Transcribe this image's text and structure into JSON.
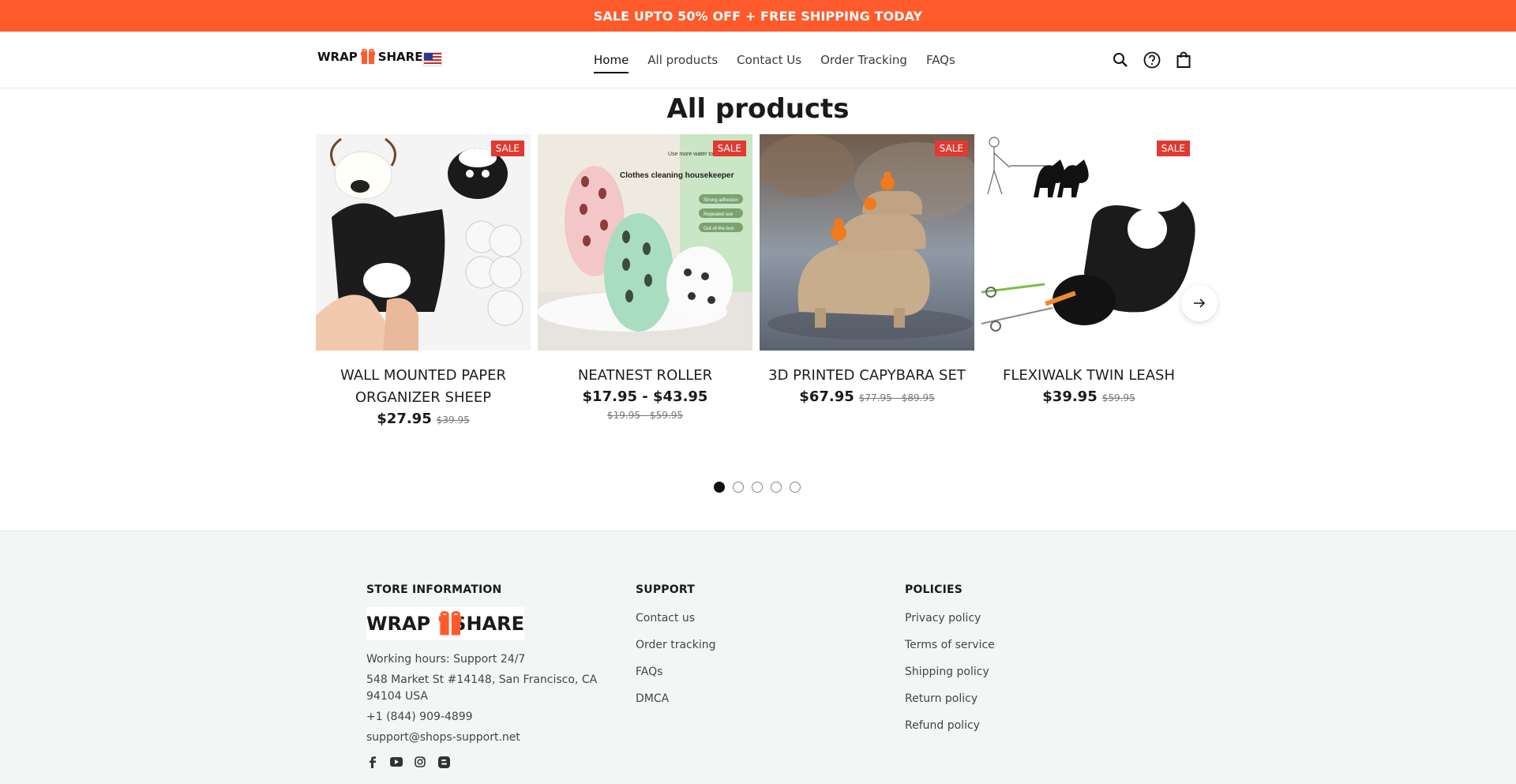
{
  "announcement": "SALE UPTO 50% OFF + FREE SHIPPING TODAY",
  "brand": {
    "left": "WRAP",
    "right": "SHARE"
  },
  "nav": [
    {
      "label": "Home",
      "active": true
    },
    {
      "label": "All products"
    },
    {
      "label": "Contact Us"
    },
    {
      "label": "Order Tracking"
    },
    {
      "label": "FAQs"
    }
  ],
  "section_title": "All products",
  "products": [
    {
      "badge": "SALE",
      "title": "WALL MOUNTED PAPER ORGANIZER SHEEP",
      "price": "$27.95",
      "compare": "$39.95"
    },
    {
      "badge": "SALE",
      "title": "NEATNEST ROLLER",
      "price": "$17.95 - $43.95",
      "compare": "$19.95 - $59.95",
      "image_text": {
        "line1": "Use more water to remove",
        "heading": "Clothes cleaning housekeeper",
        "tags": [
          "Strong adhesion",
          "Repeated use",
          "Out-of-the-box"
        ]
      }
    },
    {
      "badge": "SALE",
      "title": "3D PRINTED CAPYBARA SET",
      "price": "$67.95",
      "compare": "$77.95 - $89.95"
    },
    {
      "badge": "SALE",
      "title": "FLEXIWALK TWIN LEASH",
      "price": "$39.95",
      "compare": "$59.95"
    }
  ],
  "carousel": {
    "pages": 5,
    "current": 1
  },
  "footer": {
    "store": {
      "heading": "STORE INFORMATION",
      "hours": "Working hours: Support 24/7",
      "address": "548 Market St #14148, San Francisco, CA 94104 USA",
      "phone": "+1 (844) 909-4899",
      "email": "support@shops-support.net"
    },
    "support": {
      "heading": "SUPPORT",
      "links": [
        "Contact us",
        "Order tracking",
        "FAQs",
        "DMCA"
      ]
    },
    "policies": {
      "heading": "POLICIES",
      "links": [
        "Privacy policy",
        "Terms of service",
        "Shipping policy",
        "Return policy",
        "Refund policy"
      ]
    },
    "social": [
      "facebook-icon",
      "youtube-icon",
      "instagram-icon",
      "blogger-icon"
    ]
  },
  "colors": {
    "accent": "#ff5a2b",
    "sale": "#e03a32",
    "footer_bg": "#f2f7f5"
  }
}
